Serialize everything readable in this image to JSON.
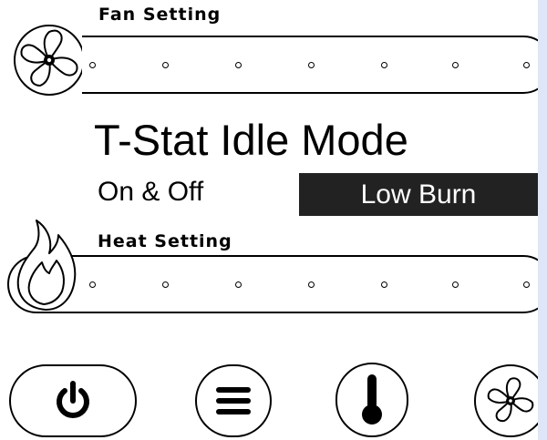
{
  "fan_setting": {
    "title": "Fan Setting",
    "icon": "fan-icon",
    "levels": 7
  },
  "idle_mode": {
    "title": "T-Stat Idle Mode",
    "options": [
      {
        "label": "On & Off",
        "selected": false
      },
      {
        "label": "Low Burn",
        "selected": true
      }
    ]
  },
  "heat_setting": {
    "title": "Heat Setting",
    "icon": "flame-icon",
    "levels": 7
  },
  "bottom_buttons": [
    {
      "icon": "power-icon"
    },
    {
      "icon": "menu-icon"
    },
    {
      "icon": "thermometer-icon"
    },
    {
      "icon": "fan-icon"
    }
  ],
  "colors": {
    "background": "#dfe6f7",
    "panel": "#ffffff",
    "selected_fill": "#222222",
    "selected_text": "#ffffff"
  }
}
